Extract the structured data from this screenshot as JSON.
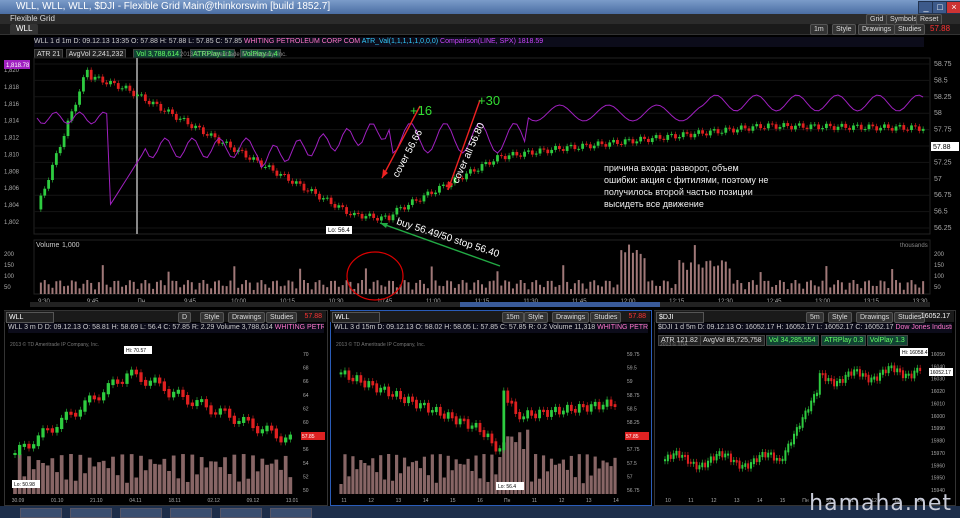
{
  "window": {
    "title": "WLL, WLL, WLL, $DJI - Flexible Grid Main@thinkorswim [build 1852.7]",
    "menu_left": "Flexible Grid",
    "menu_right": [
      "Grid",
      "Symbols",
      "Reset"
    ]
  },
  "main_chart": {
    "symbol": "WLL",
    "price": "57.88",
    "header": "WLL 1 d 1m",
    "date": "D: 09.12.13 13:35",
    "o": "O: 57.88",
    "h": "H: 57.88",
    "l": "L: 57.85",
    "c": "C: 57.85",
    "company": "WHITING PETROLEUM CORP COM",
    "studies": [
      "ATR 21",
      "AvgVol 2,241,232",
      "Vol 3,788,614",
      "ATRPlay 1.1",
      "VolPlay 1.4"
    ],
    "indicator1": "ATR_Val(1,1,1,1,1,0,0,0)",
    "indicator2": "Comparison(LINE, SPX)",
    "indicator2_value": "1818.59",
    "copyright": "2013 © TD Ameritrade IP Company, Inc.",
    "left_tag": "1,818.78",
    "left_axis": [
      "1,820",
      "1,818",
      "1,816",
      "1,814",
      "1,812",
      "1,810",
      "1,808",
      "1,806",
      "1,804",
      "1,802"
    ],
    "right_axis": [
      "58.75",
      "58.5",
      "58.25",
      "58",
      "57.75",
      "57.5",
      "57.25",
      "57",
      "56.75",
      "56.5",
      "56.25"
    ],
    "right_tag": "57.88",
    "low_label": "Lo: 56.4",
    "volume_label": "Volume",
    "volume_value": "1,000",
    "volume_axis": [
      "200",
      "150",
      "100",
      "50"
    ],
    "volume_unit": "thousands",
    "time_axis": [
      "9:30",
      "9:45",
      "Пн",
      "9:45",
      "10:00",
      "10:15",
      "10:30",
      "10:45",
      "11:00",
      "11:15",
      "11:30",
      "11:45",
      "12:00",
      "12:15",
      "12:30",
      "12:45",
      "13:00",
      "13:15",
      "13:30"
    ],
    "toolbar": {
      "period": "1m",
      "style": "Style",
      "drawings": "Drawings",
      "studies": "Studies"
    }
  },
  "annotations": {
    "cover1": "cover 56.66",
    "cover2": "cover all 56.80",
    "plus16": "+16",
    "plus30": "+30",
    "buy": "buy 56.49/50 stop 56.40",
    "note": [
      "причина входа: разворот, объем",
      "ошибки: акция с фитилями, поэтому не",
      "получилось второй частью позиции",
      "высидеть все движение"
    ]
  },
  "panels": [
    {
      "symbol": "WLL",
      "price": "57.88",
      "period": "D",
      "header": "WLL 3 m D",
      "date": "D: 09.12.13",
      "o": "O: 58.81",
      "h": "H: 58.69",
      "l": "L: 56.4",
      "c": "C: 57.85",
      "extra": "R: 2.29",
      "vol": "Volume 3,788,614",
      "company": "WHITING PETROLEUM CORP COM",
      "copyright": "2013 © TD Ameritrade IP Company, Inc.",
      "hi": "Hi: 70.57",
      "lo": "Lo: 50.98",
      "axis": [
        "70",
        "68",
        "66",
        "64",
        "62",
        "60",
        "58",
        "56",
        "54",
        "52",
        "50"
      ],
      "tag": "57.85",
      "time": [
        "30.09",
        "01.10",
        "21.10",
        "04.11",
        "18.11",
        "02.12",
        "09.12",
        "13.01"
      ]
    },
    {
      "symbol": "WLL",
      "price": "57.88",
      "period": "15m",
      "header": "WLL 3 d 15m",
      "date": "D: 09.12.13",
      "o": "O: 58.02",
      "h": "H: 58.05",
      "l": "L: 57.85",
      "c": "C: 57.85",
      "extra": "R: 0.2",
      "vol": "Volume 11,318",
      "company": "WHITING PETROLEUM CORP COM",
      "copyright": "2013 © TD Ameritrade IP Company, Inc.",
      "hi": "",
      "lo": "Lo: 56.4",
      "axis": [
        "59.75",
        "59.5",
        "59",
        "58.75",
        "58.5",
        "58.25",
        "58",
        "57.75",
        "57.5",
        "57",
        "56.75"
      ],
      "tag": "57.85",
      "time": [
        "11",
        "12",
        "13",
        "14",
        "15",
        "16",
        "Пн",
        "11",
        "12",
        "13",
        "14"
      ]
    },
    {
      "symbol": "$DJI",
      "price": "16052.17",
      "period": "5m",
      "header": "$DJI 1 d 5m",
      "date": "D: 09.12.13",
      "o": "O: 16052.17",
      "h": "H: 16052.17",
      "l": "L: 16052.17",
      "c": "C: 16052.17",
      "extra": "",
      "vol": "",
      "company": "Dow Jones Industrial",
      "copyright": "2013 © TDA",
      "studies": [
        "ATR 121.82",
        "AvgVol 85,725,758",
        "Vol 34,285,554",
        "ATRPlay 0.3",
        "VolPlay 1.3"
      ],
      "hi": "Hi: 16058.4",
      "lo": "",
      "axis": [
        "16050",
        "16040",
        "16030",
        "16020",
        "16010",
        "16000",
        "15990",
        "15980",
        "15970",
        "15960",
        "15950",
        "15940"
      ],
      "tag": "16052.17",
      "time": [
        "10",
        "11",
        "12",
        "13",
        "14",
        "15",
        "Пн",
        "10",
        "11",
        "12",
        "13",
        "14"
      ]
    }
  ],
  "watermark": "hamaha.net",
  "colors": {
    "up": "#2ecc40",
    "down": "#e02020",
    "compare": "#a020c0",
    "volume": "#a07878",
    "accent": "#3a5b9a"
  }
}
